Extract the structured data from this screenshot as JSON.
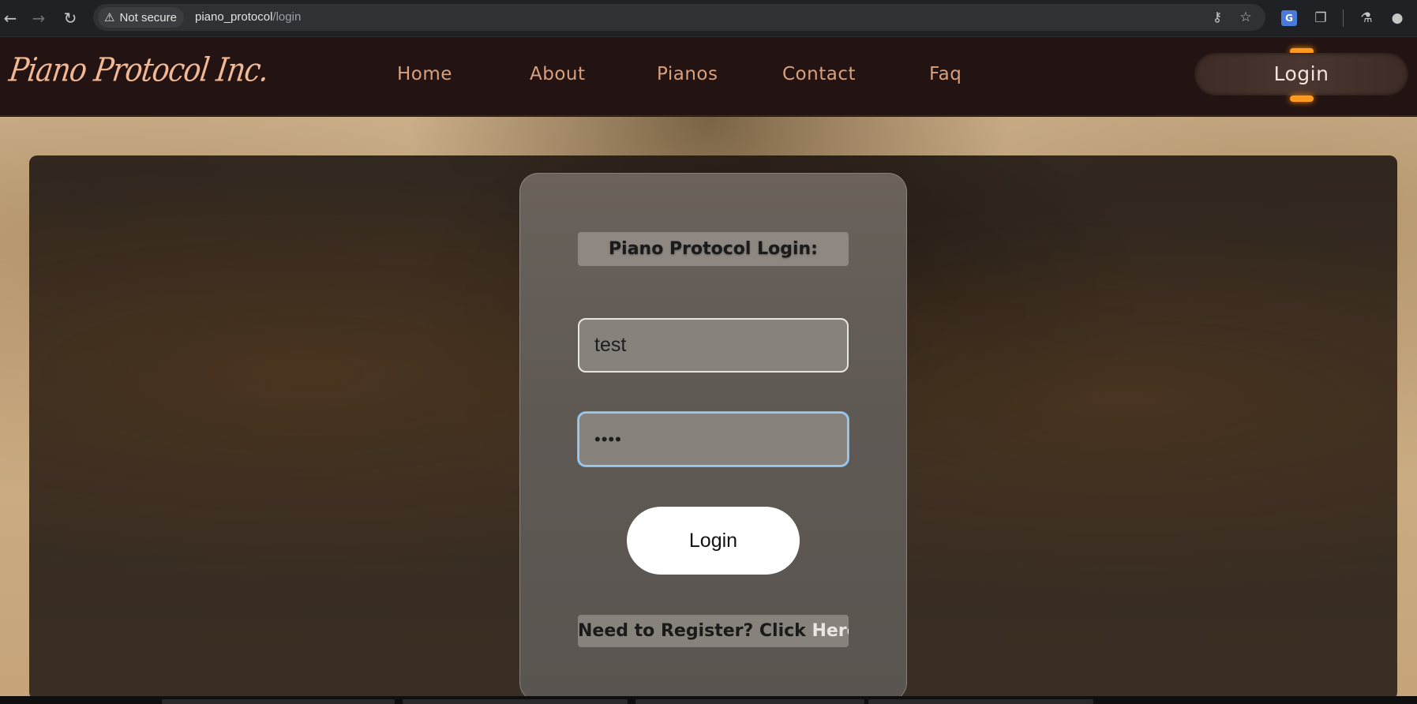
{
  "browser": {
    "security_label": "Not secure",
    "url_host": "piano_protocol",
    "url_path": "/login",
    "icons": [
      "back-arrow-icon",
      "forward-arrow-icon",
      "reload-icon",
      "warning-icon",
      "key-icon",
      "star-icon",
      "translate-icon",
      "extensions-icon",
      "labs-icon",
      "profile-icon"
    ]
  },
  "site": {
    "logo_text": "Piano Protocol Inc.",
    "nav": {
      "home": "Home",
      "about": "About",
      "pianos": "Pianos",
      "contact": "Contact",
      "faq": "Faq"
    },
    "login_nav": "Login",
    "accent_color": "#ff9a1e",
    "nav_text_color": "#d9a07c"
  },
  "login_form": {
    "title": "Piano Protocol Login:",
    "username_value": "test",
    "password_mask": "••••",
    "submit_label": "Login",
    "register_prefix": "Need to Register? Click ",
    "register_link": "Here"
  }
}
